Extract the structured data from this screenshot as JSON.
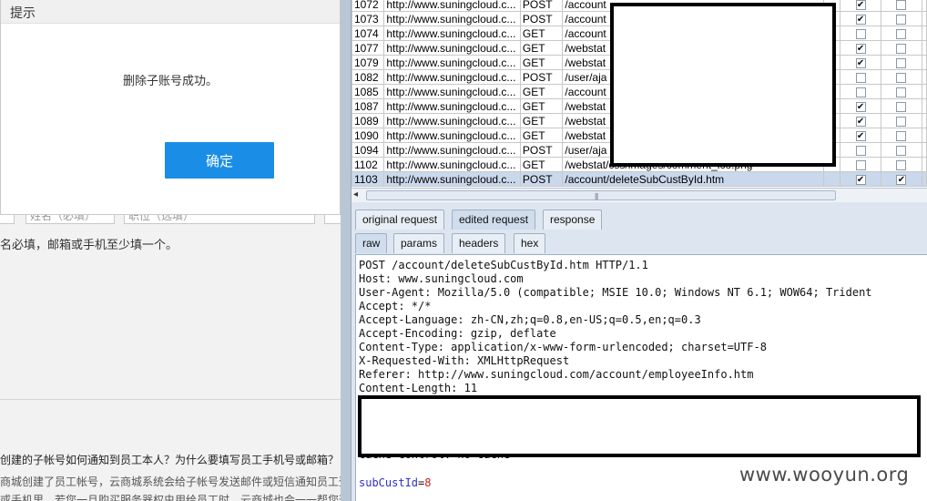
{
  "dialog": {
    "title": "提示",
    "message": "删除子账号成功。",
    "ok_label": "确定"
  },
  "left_page": {
    "field_hints": [
      "",
      "姓名（必填）",
      "职位（选填）",
      ""
    ],
    "hint": "名必填，邮箱或手机至少填一个。",
    "faq_title": "创建的子帐号如何通知到员工本人？为什么要填写员工手机号或邮箱？",
    "faq_lines": [
      "商城创建了员工帐号，云商城系统会给子帐号发送邮件或短信通知员工登",
      "或手机里，若您一旦购买服务器权虫用给员工时，云商城也会一一帮您通"
    ]
  },
  "requests": [
    {
      "id": "1072",
      "host": "http://www.suningcloud.c...",
      "method": "POST",
      "url": "/account",
      "checked1": true,
      "checked2": false
    },
    {
      "id": "1073",
      "host": "http://www.suningcloud.c...",
      "method": "POST",
      "url": "/account",
      "checked1": true,
      "checked2": false
    },
    {
      "id": "1074",
      "host": "http://www.suningcloud.c...",
      "method": "GET",
      "url": "/account",
      "checked1": false,
      "checked2": false
    },
    {
      "id": "1077",
      "host": "http://www.suningcloud.c...",
      "method": "GET",
      "url": "/webstat",
      "checked1": true,
      "checked2": false
    },
    {
      "id": "1079",
      "host": "http://www.suningcloud.c...",
      "method": "GET",
      "url": "/webstat",
      "checked1": true,
      "checked2": false
    },
    {
      "id": "1082",
      "host": "http://www.suningcloud.c...",
      "method": "POST",
      "url": "/user/aja",
      "checked1": false,
      "checked2": false
    },
    {
      "id": "1085",
      "host": "http://www.suningcloud.c...",
      "method": "GET",
      "url": "/account",
      "checked1": false,
      "checked2": false
    },
    {
      "id": "1087",
      "host": "http://www.suningcloud.c...",
      "method": "GET",
      "url": "/webstat",
      "checked1": true,
      "checked2": false
    },
    {
      "id": "1089",
      "host": "http://www.suningcloud.c...",
      "method": "GET",
      "url": "/webstat",
      "checked1": true,
      "checked2": false
    },
    {
      "id": "1090",
      "host": "http://www.suningcloud.c...",
      "method": "GET",
      "url": "/webstat",
      "checked1": true,
      "checked2": false
    },
    {
      "id": "1094",
      "host": "http://www.suningcloud.c...",
      "method": "POST",
      "url": "/user/aja",
      "checked1": false,
      "checked2": false
    },
    {
      "id": "1102",
      "host": "http://www.suningcloud.c...",
      "method": "GET",
      "url": "/webstat/css/images/comment_ico.png",
      "checked1": false,
      "checked2": false
    },
    {
      "id": "1103",
      "host": "http://www.suningcloud.c...",
      "method": "POST",
      "url": "/account/deleteSubCustById.htm",
      "checked1": true,
      "checked2": true,
      "selected": true
    }
  ],
  "check_mark": "✔",
  "scroll": {
    "left_arrow": "◂",
    "grip": "|||"
  },
  "tabs_top": [
    "original request",
    "edited request",
    "response"
  ],
  "tabs_top_active": 1,
  "tabs_sub": [
    "raw",
    "params",
    "headers",
    "hex"
  ],
  "tabs_sub_active": 0,
  "request_raw": [
    "POST /account/deleteSubCustById.htm HTTP/1.1",
    "Host: www.suningcloud.com",
    "User-Agent: Mozilla/5.0 (compatible; MSIE 10.0; Windows NT 6.1; WOW64; Trident",
    "Accept: */*",
    "Accept-Language: zh-CN,zh;q=0.8,en-US;q=0.5,en;q=0.3",
    "Accept-Encoding: gzip, deflate",
    "Content-Type: application/x-www-form-urlencoded; charset=UTF-8",
    "X-Requested-With: XMLHttpRequest",
    "Referer: http://www.suningcloud.com/account/employeeInfo.htm",
    "Content-Length: 11"
  ],
  "request_partial": "Cache-Control: no-cache",
  "param_key": "subCustId",
  "param_eq": "=",
  "param_value": "8",
  "watermark": "www.wooyun.org",
  "colors": {
    "accent": "#1a8ee6",
    "selected_row": "#cad8ec",
    "param_key": "#3030cc",
    "param_value": "#c02020"
  }
}
